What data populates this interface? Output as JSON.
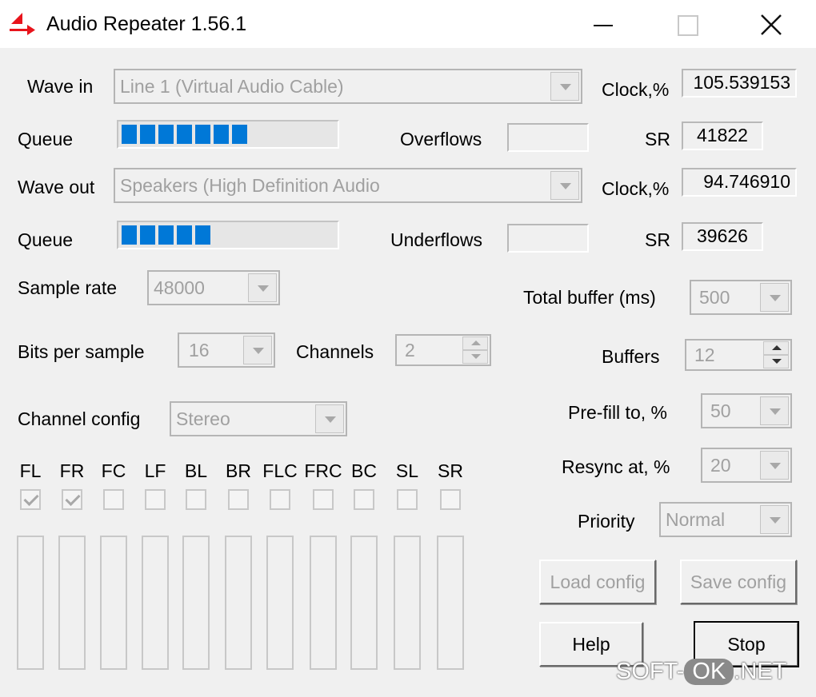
{
  "window": {
    "title": "Audio Repeater 1.56.1",
    "icon": "red-speaker-arrow-icon",
    "controls": [
      "minimize",
      "maximize",
      "close"
    ]
  },
  "input": {
    "label": "Wave in",
    "device": "Line 1 (Virtual Audio Cable)",
    "clock_label": "Clock,%",
    "clock_value": "105.539153",
    "queue_label": "Queue",
    "queue_segments": 7,
    "overflows_label": "Overflows",
    "overflows_value": "",
    "sr_label": "SR",
    "sr_value": "41822"
  },
  "output": {
    "label": "Wave out",
    "device": "Speakers (High Definition Audio",
    "clock_label": "Clock,%",
    "clock_value": "94.746910",
    "queue_label": "Queue",
    "queue_segments": 5,
    "underflows_label": "Underflows",
    "underflows_value": "",
    "sr_label": "SR",
    "sr_value": "39626"
  },
  "format": {
    "sample_rate_label": "Sample rate",
    "sample_rate": "48000",
    "bits_label": "Bits per sample",
    "bits": "16",
    "channels_label": "Channels",
    "channels": "2",
    "channel_config_label": "Channel config",
    "channel_config": "Stereo"
  },
  "channels": [
    {
      "name": "FL",
      "checked": true
    },
    {
      "name": "FR",
      "checked": true
    },
    {
      "name": "FC",
      "checked": false
    },
    {
      "name": "LF",
      "checked": false
    },
    {
      "name": "BL",
      "checked": false
    },
    {
      "name": "BR",
      "checked": false
    },
    {
      "name": "FLC",
      "checked": false
    },
    {
      "name": "FRC",
      "checked": false
    },
    {
      "name": "BC",
      "checked": false
    },
    {
      "name": "SL",
      "checked": false
    },
    {
      "name": "SR",
      "checked": false
    }
  ],
  "buffering": {
    "total_buffer_label": "Total buffer (ms)",
    "total_buffer": "500",
    "buffers_label": "Buffers",
    "buffers": "12",
    "prefill_label": "Pre-fill to, %",
    "prefill": "50",
    "resync_label": "Resync at, %",
    "resync": "20",
    "priority_label": "Priority",
    "priority": "Normal"
  },
  "buttons": {
    "load_config": "Load config",
    "save_config": "Save config",
    "help": "Help",
    "stop": "Stop"
  },
  "watermark": {
    "left": "SOFT-",
    "pill": "OK",
    "right": ".NET"
  },
  "colors": {
    "queue_fill": "#0078d7",
    "app_icon": "#e8141c"
  }
}
